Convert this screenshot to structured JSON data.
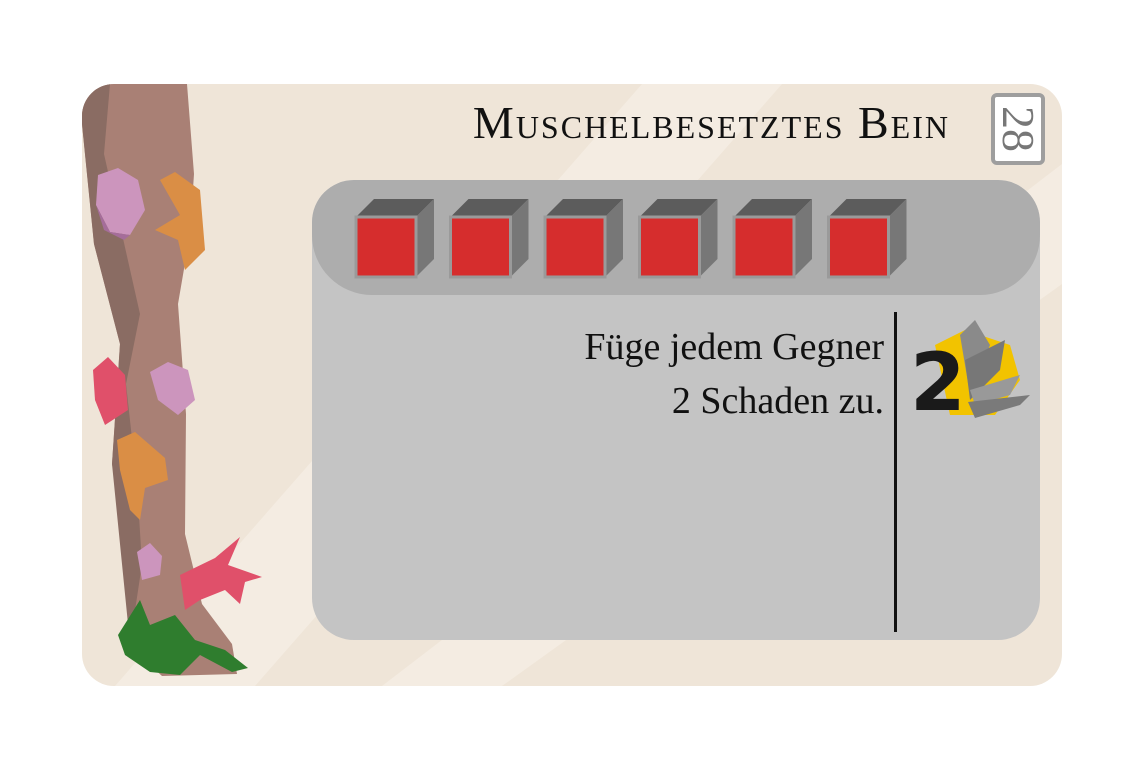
{
  "card": {
    "title": "Muschelbesetztes Bein",
    "number": "28",
    "cost_cubes": 6,
    "cube_color": "#d62d2d",
    "effect_lines": [
      "Füge jedem Gegner",
      "2 Schaden zu."
    ],
    "effect_icon": "damage-all-icon",
    "effect_icon_value": "2"
  }
}
